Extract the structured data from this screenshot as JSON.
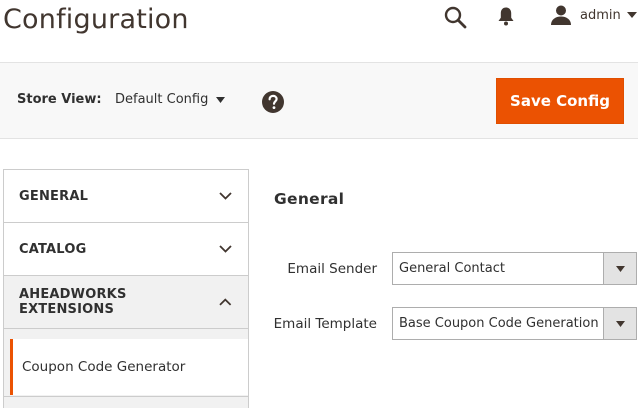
{
  "header": {
    "title": "Configuration",
    "user_name": "admin"
  },
  "toolbar": {
    "store_view_label": "Store View:",
    "store_view_value": "Default Config",
    "save_label": "Save Config"
  },
  "sidebar": {
    "items": [
      {
        "label": "GENERAL"
      },
      {
        "label": "CATALOG"
      },
      {
        "label": "AHEADWORKS EXTENSIONS"
      }
    ],
    "sub_items": [
      {
        "label": "Coupon Code Generator"
      }
    ]
  },
  "main": {
    "section_title": "General",
    "fields": [
      {
        "label": "Email Sender",
        "value": "General Contact"
      },
      {
        "label": "Email Template",
        "value": "Base Coupon Code Generation"
      }
    ]
  },
  "colors": {
    "accent": "#eb5202",
    "toolbar_bg": "#f8f8f8",
    "text": "#303030"
  }
}
